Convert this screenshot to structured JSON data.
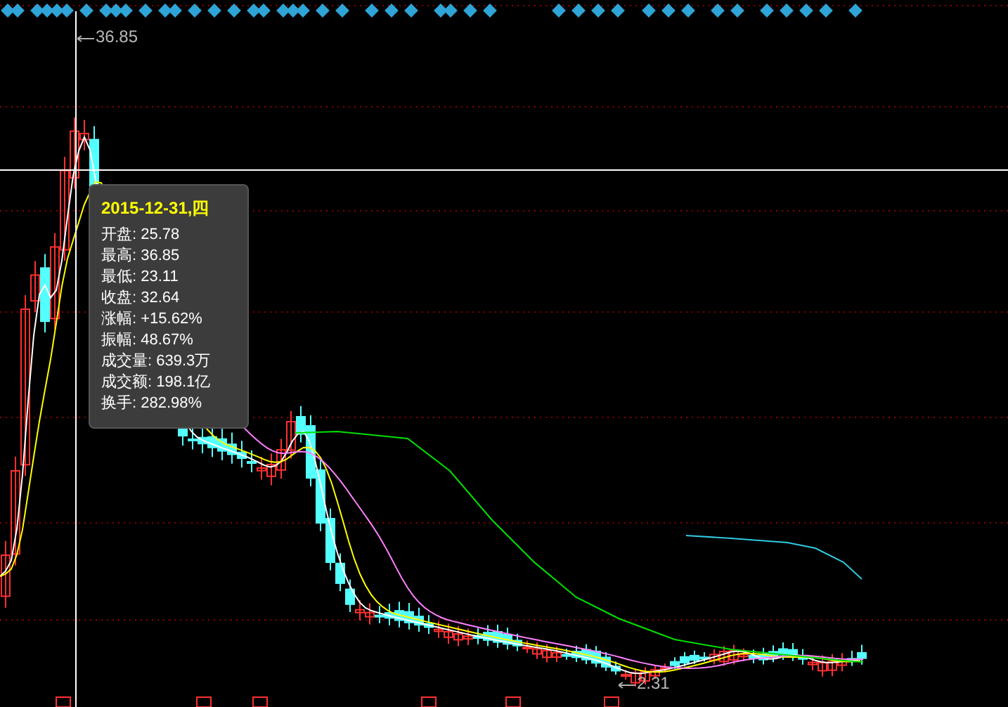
{
  "chart": {
    "high_label": "36.85",
    "low_label": "2.31"
  },
  "tooltip": {
    "title": "2015-12-31,四",
    "rows": [
      "开盘: 25.78",
      "最高: 36.85",
      "最低: 23.11",
      "收盘: 32.64",
      "涨幅: +15.62%",
      "振幅: 48.67%",
      "成交量: 639.3万",
      "成交额: 198.1亿",
      "换手: 282.98%"
    ]
  }
}
